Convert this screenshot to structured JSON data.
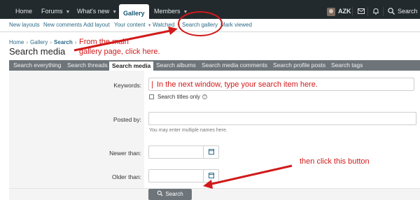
{
  "topnav": {
    "home": "Home",
    "forums": "Forums",
    "whats_new": "What's new",
    "gallery": "Gallery",
    "members": "Members",
    "username": "AZK",
    "search": "Search"
  },
  "subnav": {
    "new_layouts": "New layouts",
    "new_comments": "New comments",
    "add_layout": "Add layout",
    "your_content": "Your content",
    "watched": "Watched",
    "search_gallery": "Search gallery",
    "mark_viewed": "Mark viewed"
  },
  "breadcrumb": {
    "home": "Home",
    "gallery": "Gallery",
    "current": "Search"
  },
  "page_title": "Search media",
  "tabs": [
    {
      "label": "Search everything"
    },
    {
      "label": "Search threads"
    },
    {
      "label": "Search media"
    },
    {
      "label": "Search albums"
    },
    {
      "label": "Search media comments"
    },
    {
      "label": "Search profile posts"
    },
    {
      "label": "Search tags"
    }
  ],
  "form": {
    "keywords_label": "Keywords:",
    "search_titles_only": "Search titles only",
    "posted_by_label": "Posted by:",
    "posted_by_hint": "You may enter multiple names here.",
    "newer_than_label": "Newer than:",
    "older_than_label": "Older than:",
    "search_button": "Search"
  },
  "annotations": {
    "note1_line1": "From the main",
    "note1_line2": "gallery page, click here.",
    "note2": "In the next window, type your search item here.",
    "note3": "then click this button"
  },
  "colors": {
    "nav_bg": "#222a2e",
    "accent": "#2a6b87",
    "tab_bg": "#6e757a",
    "annotation": "#d11a1a"
  }
}
